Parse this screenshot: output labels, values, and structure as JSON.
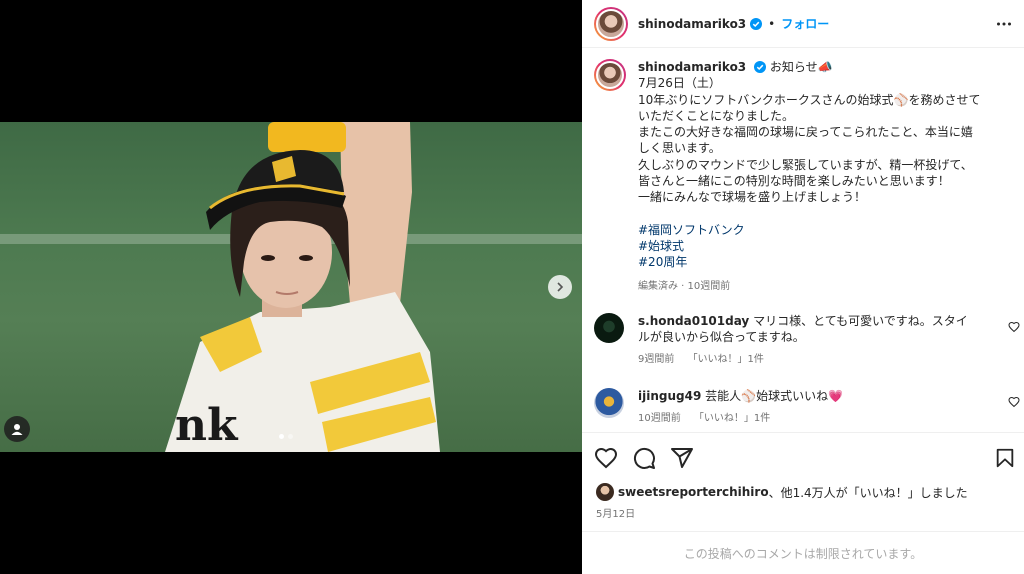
{
  "post": {
    "username": "shinodamariko3",
    "follow_label": "フォロー",
    "separator": "•",
    "caption_lines": [
      "お知らせ📣",
      "7月26日（土）",
      "10年ぶりにソフトバンクホークスさんの始球式⚾️を務めさせて",
      "いただくことになりました。",
      "またこの大好きな福岡の球場に戻ってこられたこと、本当に嬉",
      "しく思います。",
      "久しぶりのマウンドで少し緊張していますが、精一杯投げて、",
      "皆さんと一緒にこの特別な時間を楽しみたいと思います！",
      "一緒にみんなで球場を盛り上げましょう！"
    ],
    "hashtags": [
      "#福岡ソフトバンク",
      "#始球式",
      "#20周年"
    ],
    "caption_meta": "編集済み · 10週間前"
  },
  "comments": [
    {
      "username": "s.honda0101day",
      "text": "マリコ様、とても可愛いですね。スタイルが良いから似合ってますね。",
      "time": "9週間前",
      "likes": "「いいね！」1件"
    },
    {
      "username": "ijingug49",
      "text": "芸能人⚾️始球式いいね💗",
      "time": "10週間前",
      "likes": "「いいね！」1件"
    }
  ],
  "likes_summary": {
    "liker": "sweetsreporterchihiro",
    "text": "、他1.4万人が「いいね！」しました"
  },
  "post_date": "5月12日",
  "comments_restricted": "この投稿へのコメントは制限されています。",
  "colors": {
    "accent": "#0095f6",
    "hashtag": "#00376b",
    "verified": "#0095f6",
    "like_heart": "#ed4956"
  }
}
